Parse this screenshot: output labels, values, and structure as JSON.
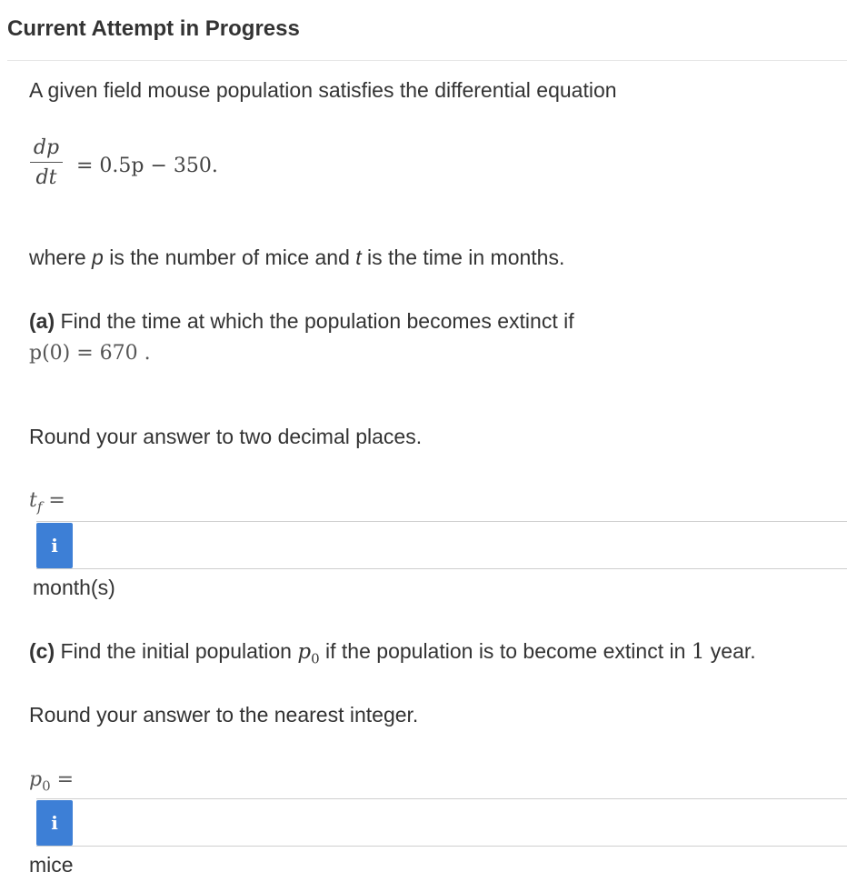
{
  "header": {
    "title": "Current Attempt in Progress"
  },
  "problem": {
    "intro": "A given field mouse population satisfies the differential equation",
    "equation": {
      "numerator": "dp",
      "denominator": "dt",
      "rhs": "= 0.5p − 350."
    },
    "where_prefix": "where ",
    "where_p": "p",
    "where_mid": " is the number of mice and ",
    "where_t": "t",
    "where_suffix": " is the time in months."
  },
  "part_a": {
    "label": "(a)",
    "text": " Find the time at which the population becomes extinct if",
    "condition": "p(0)  =  670   .",
    "round_text": "Round your answer to two decimal places.",
    "var_label": "t",
    "var_sub": "f",
    "var_eq": " =",
    "info_icon": "i",
    "unit": "month(s)",
    "value": ""
  },
  "part_c": {
    "label": "(c)",
    "text_1": " Find the initial population ",
    "var_inline": "p",
    "var_inline_sub": "0",
    "text_2": " if the population is to become extinct in ",
    "one": "1",
    "text_3": " year.",
    "round_text": "Round your answer to the nearest integer.",
    "var_label": "p",
    "var_sub": "0",
    "var_eq": " =",
    "info_icon": "i",
    "unit": "mice",
    "value": ""
  },
  "colors": {
    "info_button": "#3d7fd6",
    "text": "#333333",
    "rule": "#cfcfcf"
  }
}
